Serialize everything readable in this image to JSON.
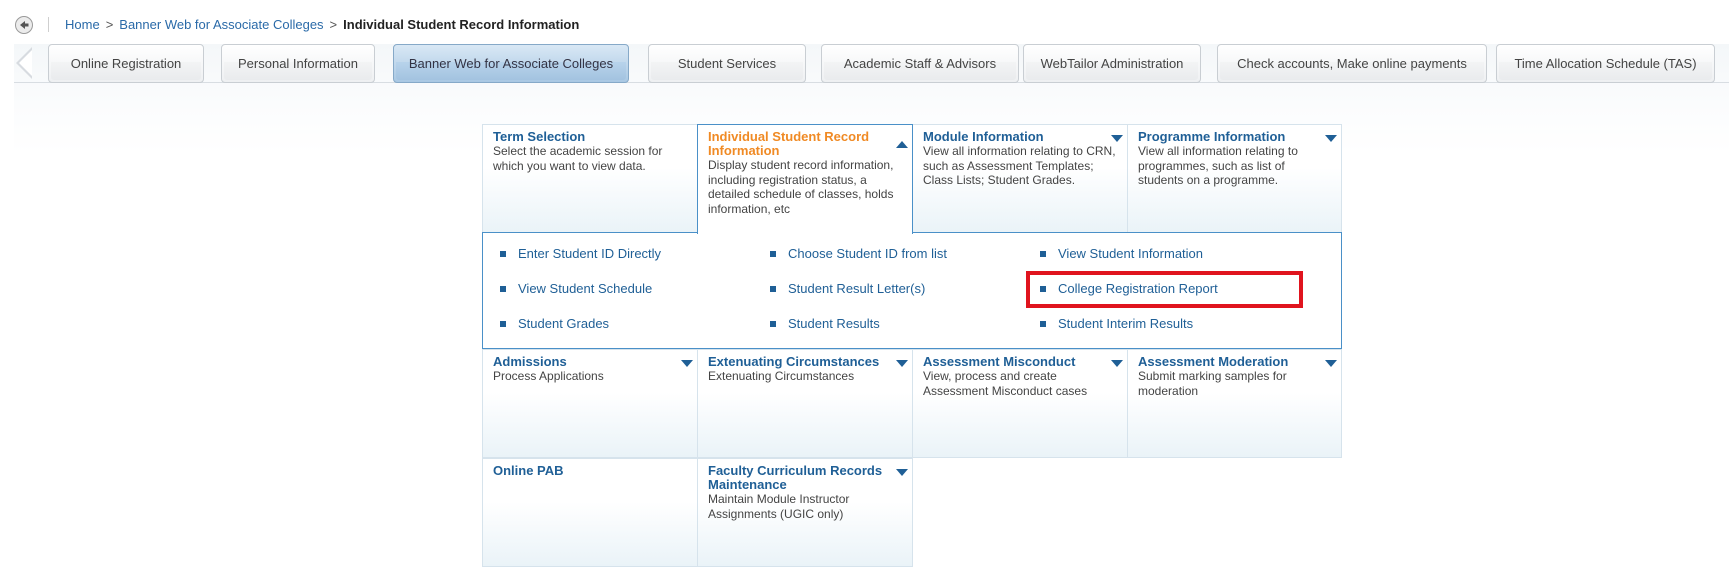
{
  "breadcrumb": {
    "home": "Home",
    "parent": "Banner Web for Associate Colleges",
    "current": "Individual Student Record Information",
    "separator": ">"
  },
  "tabs": [
    {
      "label": "Online Registration",
      "active": false
    },
    {
      "label": "Personal Information",
      "active": false
    },
    {
      "label": "Banner Web for Associate Colleges",
      "active": true
    },
    {
      "label": "Student Services",
      "active": false
    },
    {
      "label": "Academic Staff & Advisors",
      "active": false
    },
    {
      "label": "WebTailor Administration",
      "active": false
    },
    {
      "label": "Check accounts, Make online payments",
      "active": false
    },
    {
      "label": "Time Allocation Schedule (TAS)",
      "active": false
    }
  ],
  "tiles": {
    "term_selection": {
      "title": "Term Selection",
      "desc": "Select the academic session for which you want to view data."
    },
    "individual_record": {
      "title": "Individual Student Record Information",
      "desc": "Display student record information, including registration status, a detailed schedule of classes, holds information, etc"
    },
    "module_information": {
      "title": "Module Information",
      "desc": "View all information relating to CRN, such as Assessment Templates; Class Lists; Student Grades."
    },
    "programme_information": {
      "title": "Programme Information",
      "desc": "View all information relating to programmes, such as list of students on a programme."
    },
    "admissions": {
      "title": "Admissions",
      "desc": "Process Applications"
    },
    "extenuating": {
      "title": "Extenuating Circumstances",
      "desc": "Extenuating Circumstances"
    },
    "misconduct": {
      "title": "Assessment Misconduct",
      "desc": "View, process and create Assessment Misconduct cases"
    },
    "moderation": {
      "title": "Assessment Moderation",
      "desc": "Submit marking samples for moderation"
    },
    "online_pab": {
      "title": "Online PAB",
      "desc": ""
    },
    "faculty_curriculum": {
      "title": "Faculty Curriculum Records Maintenance",
      "desc": "Maintain Module Instructor Assignments (UGIC only)"
    }
  },
  "submenu": {
    "enter_id": "Enter Student ID Directly",
    "choose_id": "Choose Student ID from list",
    "view_info": "View Student Information",
    "view_schedule": "View Student Schedule",
    "result_letters": "Student Result Letter(s)",
    "college_reg_report": "College Registration Report",
    "grades": "Student Grades",
    "results": "Student Results",
    "interim_results": "Student Interim Results"
  },
  "colors": {
    "link": "#1f5f96",
    "active_title": "#f08a24",
    "highlight": "#e0141e",
    "active_tab": "#a9c8e3"
  }
}
